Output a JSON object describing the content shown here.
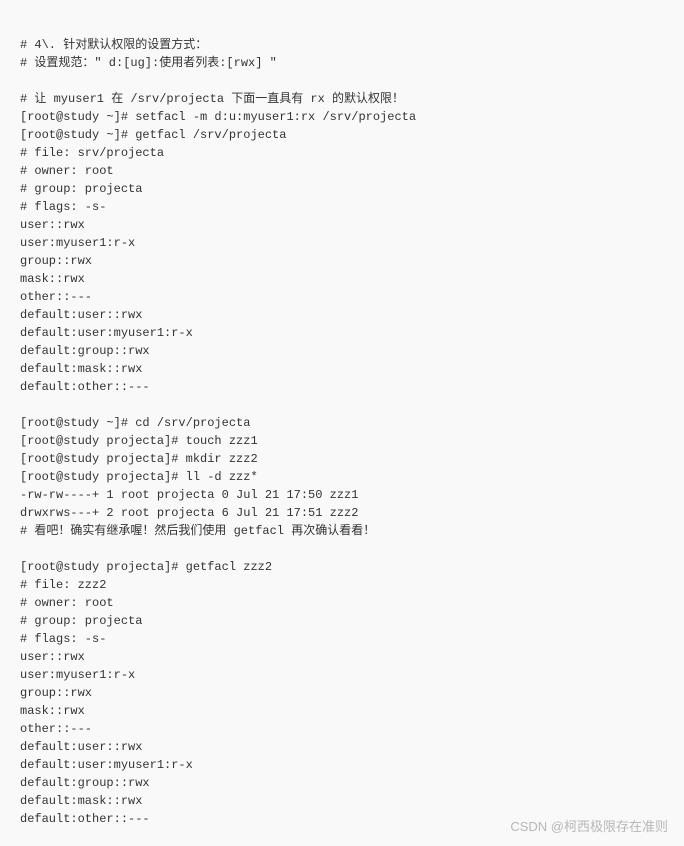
{
  "section1": {
    "title": "# 4\\. 针对默认权限的设置方式：",
    "rule": "# 设置规范：\" d:[ug]:使用者列表:[rwx] \""
  },
  "block1": {
    "comment": "# 让 myuser1 在 /srv/projecta 下面一直具有 rx 的默认权限！",
    "cmd1": "[root@study ~]# setfacl -m d:u:myuser1:rx /srv/projecta",
    "cmd2": "[root@study ~]# getfacl /srv/projecta",
    "out": [
      "# file: srv/projecta",
      "# owner: root",
      "# group: projecta",
      "# flags: -s-",
      "user::rwx",
      "user:myuser1:r-x",
      "group::rwx",
      "mask::rwx",
      "other::---",
      "default:user::rwx",
      "default:user:myuser1:r-x",
      "default:group::rwx",
      "default:mask::rwx",
      "default:other::---"
    ]
  },
  "block2": {
    "cmds": [
      "[root@study ~]# cd /srv/projecta",
      "[root@study projecta]# touch zzz1",
      "[root@study projecta]# mkdir zzz2",
      "[root@study projecta]# ll -d zzz*"
    ],
    "out": [
      "-rw-rw----+ 1 root projecta 0 Jul 21 17:50 zzz1",
      "drwxrws---+ 2 root projecta 6 Jul 21 17:51 zzz2"
    ],
    "note": "# 看吧！确实有继承喔！然后我们使用 getfacl 再次确认看看！"
  },
  "block3": {
    "cmd": "[root@study projecta]# getfacl zzz2",
    "out": [
      "# file: zzz2",
      "# owner: root",
      "# group: projecta",
      "# flags: -s-",
      "user::rwx",
      "user:myuser1:r-x",
      "group::rwx",
      "mask::rwx",
      "other::---",
      "default:user::rwx",
      "default:user:myuser1:r-x",
      "default:group::rwx",
      "default:mask::rwx",
      "default:other::---"
    ]
  },
  "watermark": "CSDN @柯西极限存在准则"
}
